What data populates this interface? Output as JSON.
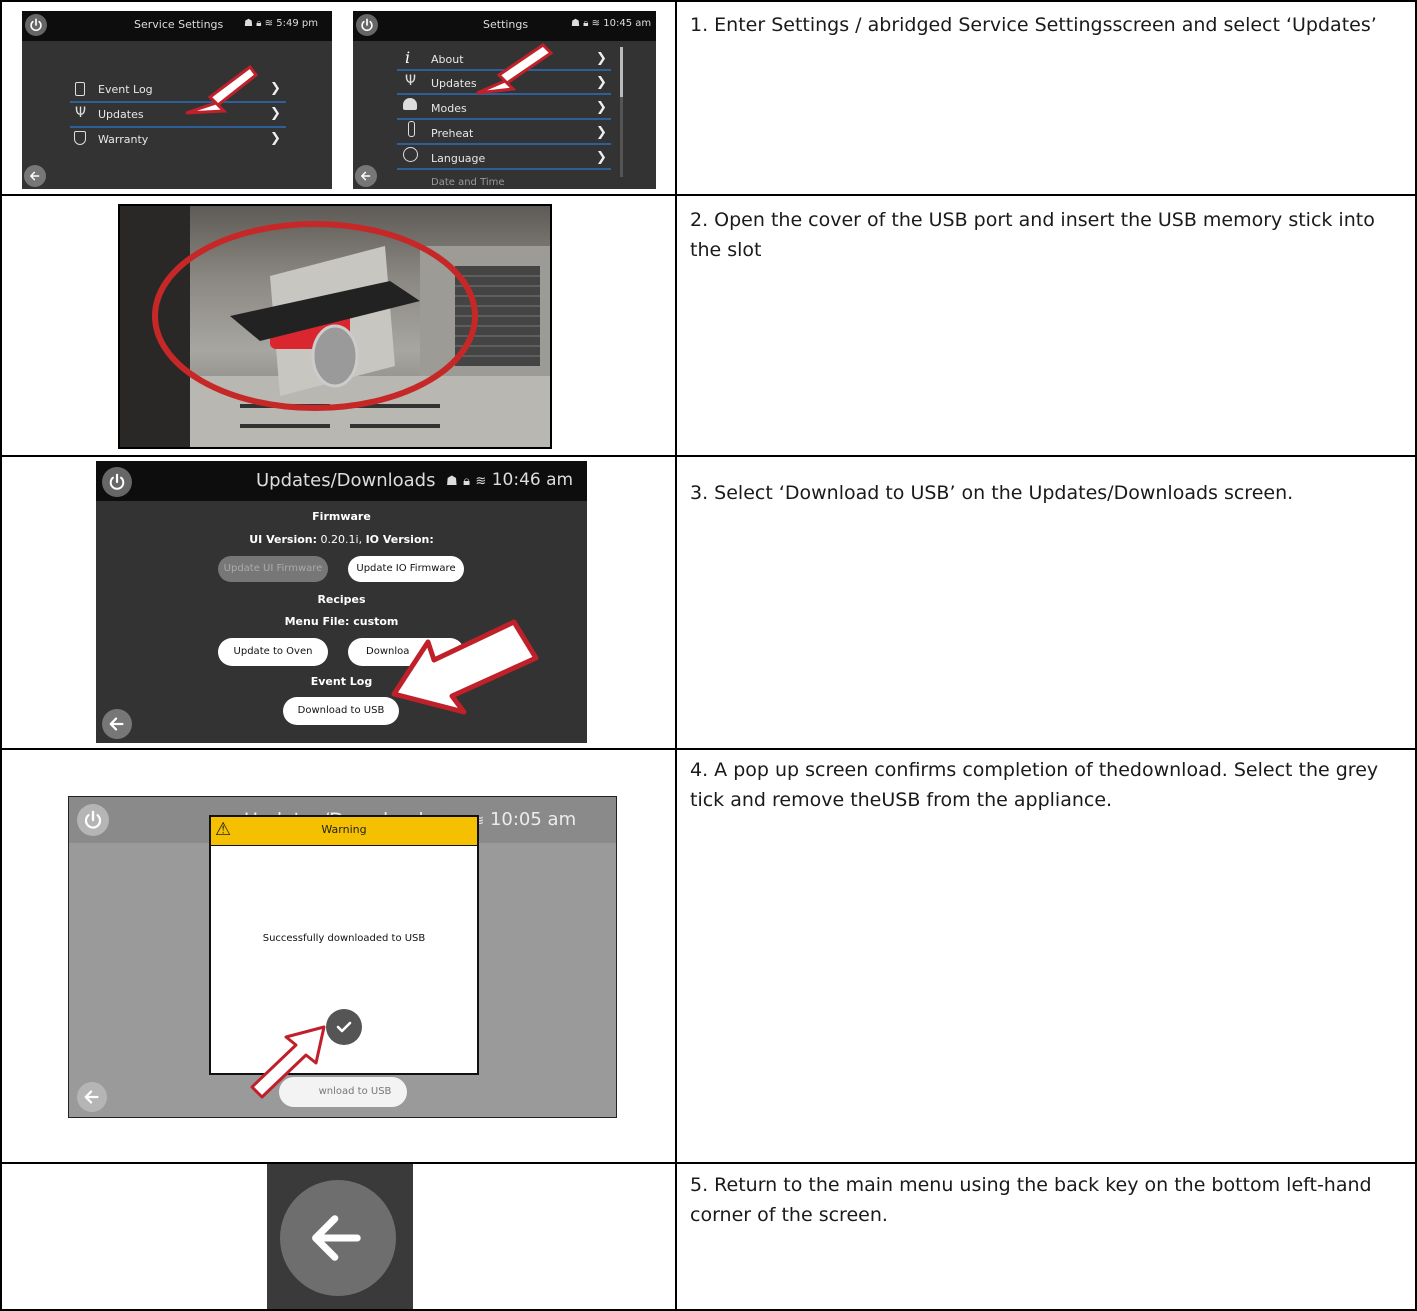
{
  "steps": [
    {
      "text": "1. Enter Settings / abridged Service Settingsscreen and select ‘Updates’"
    },
    {
      "text": "2. Open the cover of the USB port and insert the USB memory stick into the slot"
    },
    {
      "text": "3. Select ‘Download to USB’ on the Updates/Downloads screen."
    },
    {
      "text": "4. A pop up screen confirms completion of thedownload. Select the grey tick and remove theUSB from the appliance."
    },
    {
      "text": "5. Return to the main menu using the back key on the bottom left-hand corner of the screen."
    }
  ],
  "screen_service": {
    "title": "Service Settings",
    "time": "5:49 pm",
    "items": [
      "Event Log",
      "Updates",
      "Warranty"
    ]
  },
  "screen_settings": {
    "title": "Settings",
    "time": "10:45 am",
    "items": [
      "About",
      "Updates",
      "Modes",
      "Preheat",
      "Language",
      "Date and Time"
    ]
  },
  "screen_updates": {
    "title": "Updates/Downloads",
    "time": "10:46 am",
    "firmware_heading": "Firmware",
    "ui_version_label": "UI Version:",
    "ui_version_value": "0.20.1i",
    "io_version_label": "IO Version:",
    "update_ui_label": "Update UI Firmware",
    "update_io_label": "Update IO Firmware",
    "recipes_heading": "Recipes",
    "menu_file_label": "Menu File: custom",
    "update_oven_label": "Update to Oven",
    "download_partial_label": "Downloa",
    "event_log_heading": "Event Log",
    "download_usb_label": "Download to USB"
  },
  "screen_popup": {
    "title": "Updates/Downloads",
    "time": "10:05 am",
    "warning_title": "Warning",
    "message": "Successfully downloaded to USB",
    "download_partial_label": "wnload to USB"
  },
  "colors": {
    "screen_bg": "#333333",
    "topbar_bg": "#0d0d0d",
    "menu_line": "#2e5f99",
    "arrow_red": "#c0202a",
    "warning_yellow": "#f5c000",
    "popup_screen_bg": "#9a9a9a"
  }
}
